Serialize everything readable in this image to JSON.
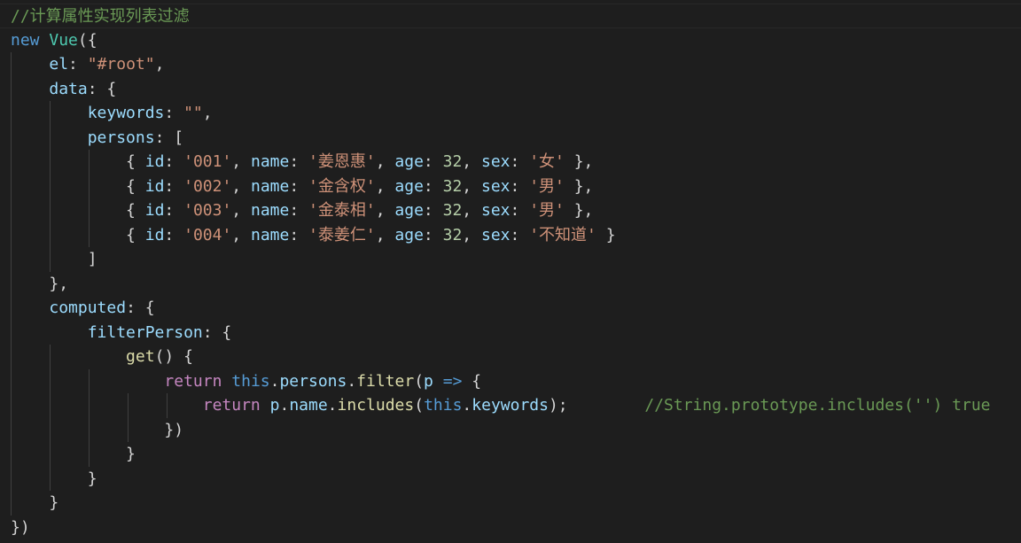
{
  "editor": {
    "colors": {
      "background": "#1e1e1e",
      "comment": "#6a9955",
      "keyword": "#569cd6",
      "control": "#c586c0",
      "class": "#4ec9b0",
      "function": "#dcdcaa",
      "property": "#9cdcfe",
      "string": "#ce9178",
      "number": "#b5cea8",
      "punctuation": "#d4d4d4"
    },
    "lines": [
      {
        "t": [
          {
            "c": "c",
            "v": "//计算属性实现列表过滤"
          }
        ]
      },
      {
        "t": [
          {
            "c": "k",
            "v": "new"
          },
          {
            "c": "sp",
            "v": " "
          },
          {
            "c": "cls",
            "v": "Vue"
          },
          {
            "c": "pu",
            "v": "({"
          }
        ]
      },
      {
        "t": [
          {
            "c": "sp",
            "v": "    "
          },
          {
            "c": "p",
            "v": "el"
          },
          {
            "c": "pu",
            "v": ": "
          },
          {
            "c": "s",
            "v": "\"#root\""
          },
          {
            "c": "pu",
            "v": ","
          }
        ]
      },
      {
        "t": [
          {
            "c": "sp",
            "v": "    "
          },
          {
            "c": "p",
            "v": "data"
          },
          {
            "c": "pu",
            "v": ": {"
          }
        ]
      },
      {
        "t": [
          {
            "c": "sp",
            "v": "        "
          },
          {
            "c": "p",
            "v": "keywords"
          },
          {
            "c": "pu",
            "v": ": "
          },
          {
            "c": "s",
            "v": "\"\""
          },
          {
            "c": "pu",
            "v": ","
          }
        ]
      },
      {
        "t": [
          {
            "c": "sp",
            "v": "        "
          },
          {
            "c": "p",
            "v": "persons"
          },
          {
            "c": "pu",
            "v": ": ["
          }
        ]
      },
      {
        "t": [
          {
            "c": "sp",
            "v": "            "
          },
          {
            "c": "pu",
            "v": "{ "
          },
          {
            "c": "p",
            "v": "id"
          },
          {
            "c": "pu",
            "v": ": "
          },
          {
            "c": "s",
            "v": "'001'"
          },
          {
            "c": "pu",
            "v": ", "
          },
          {
            "c": "p",
            "v": "name"
          },
          {
            "c": "pu",
            "v": ": "
          },
          {
            "c": "s",
            "v": "'姜恩惠'"
          },
          {
            "c": "pu",
            "v": ", "
          },
          {
            "c": "p",
            "v": "age"
          },
          {
            "c": "pu",
            "v": ": "
          },
          {
            "c": "n",
            "v": "32"
          },
          {
            "c": "pu",
            "v": ", "
          },
          {
            "c": "p",
            "v": "sex"
          },
          {
            "c": "pu",
            "v": ": "
          },
          {
            "c": "s",
            "v": "'女'"
          },
          {
            "c": "pu",
            "v": " },"
          }
        ]
      },
      {
        "t": [
          {
            "c": "sp",
            "v": "            "
          },
          {
            "c": "pu",
            "v": "{ "
          },
          {
            "c": "p",
            "v": "id"
          },
          {
            "c": "pu",
            "v": ": "
          },
          {
            "c": "s",
            "v": "'002'"
          },
          {
            "c": "pu",
            "v": ", "
          },
          {
            "c": "p",
            "v": "name"
          },
          {
            "c": "pu",
            "v": ": "
          },
          {
            "c": "s",
            "v": "'金含权'"
          },
          {
            "c": "pu",
            "v": ", "
          },
          {
            "c": "p",
            "v": "age"
          },
          {
            "c": "pu",
            "v": ": "
          },
          {
            "c": "n",
            "v": "32"
          },
          {
            "c": "pu",
            "v": ", "
          },
          {
            "c": "p",
            "v": "sex"
          },
          {
            "c": "pu",
            "v": ": "
          },
          {
            "c": "s",
            "v": "'男'"
          },
          {
            "c": "pu",
            "v": " },"
          }
        ]
      },
      {
        "t": [
          {
            "c": "sp",
            "v": "            "
          },
          {
            "c": "pu",
            "v": "{ "
          },
          {
            "c": "p",
            "v": "id"
          },
          {
            "c": "pu",
            "v": ": "
          },
          {
            "c": "s",
            "v": "'003'"
          },
          {
            "c": "pu",
            "v": ", "
          },
          {
            "c": "p",
            "v": "name"
          },
          {
            "c": "pu",
            "v": ": "
          },
          {
            "c": "s",
            "v": "'金泰相'"
          },
          {
            "c": "pu",
            "v": ", "
          },
          {
            "c": "p",
            "v": "age"
          },
          {
            "c": "pu",
            "v": ": "
          },
          {
            "c": "n",
            "v": "32"
          },
          {
            "c": "pu",
            "v": ", "
          },
          {
            "c": "p",
            "v": "sex"
          },
          {
            "c": "pu",
            "v": ": "
          },
          {
            "c": "s",
            "v": "'男'"
          },
          {
            "c": "pu",
            "v": " },"
          }
        ]
      },
      {
        "t": [
          {
            "c": "sp",
            "v": "            "
          },
          {
            "c": "pu",
            "v": "{ "
          },
          {
            "c": "p",
            "v": "id"
          },
          {
            "c": "pu",
            "v": ": "
          },
          {
            "c": "s",
            "v": "'004'"
          },
          {
            "c": "pu",
            "v": ", "
          },
          {
            "c": "p",
            "v": "name"
          },
          {
            "c": "pu",
            "v": ": "
          },
          {
            "c": "s",
            "v": "'泰姜仁'"
          },
          {
            "c": "pu",
            "v": ", "
          },
          {
            "c": "p",
            "v": "age"
          },
          {
            "c": "pu",
            "v": ": "
          },
          {
            "c": "n",
            "v": "32"
          },
          {
            "c": "pu",
            "v": ", "
          },
          {
            "c": "p",
            "v": "sex"
          },
          {
            "c": "pu",
            "v": ": "
          },
          {
            "c": "s",
            "v": "'不知道'"
          },
          {
            "c": "pu",
            "v": " }"
          }
        ]
      },
      {
        "t": [
          {
            "c": "sp",
            "v": "        "
          },
          {
            "c": "pu",
            "v": "]"
          }
        ]
      },
      {
        "t": [
          {
            "c": "sp",
            "v": "    "
          },
          {
            "c": "pu",
            "v": "},"
          }
        ]
      },
      {
        "t": [
          {
            "c": "sp",
            "v": "    "
          },
          {
            "c": "p",
            "v": "computed"
          },
          {
            "c": "pu",
            "v": ": {"
          }
        ]
      },
      {
        "t": [
          {
            "c": "sp",
            "v": "        "
          },
          {
            "c": "p",
            "v": "filterPerson"
          },
          {
            "c": "pu",
            "v": ": {"
          }
        ]
      },
      {
        "t": [
          {
            "c": "sp",
            "v": "            "
          },
          {
            "c": "fn",
            "v": "get"
          },
          {
            "c": "pu",
            "v": "() {"
          }
        ]
      },
      {
        "t": [
          {
            "c": "sp",
            "v": "                "
          },
          {
            "c": "ctl",
            "v": "return"
          },
          {
            "c": "sp",
            "v": " "
          },
          {
            "c": "k",
            "v": "this"
          },
          {
            "c": "pu",
            "v": "."
          },
          {
            "c": "p",
            "v": "persons"
          },
          {
            "c": "pu",
            "v": "."
          },
          {
            "c": "fn",
            "v": "filter"
          },
          {
            "c": "pu",
            "v": "("
          },
          {
            "c": "v",
            "v": "p"
          },
          {
            "c": "sp",
            "v": " "
          },
          {
            "c": "k",
            "v": "=>"
          },
          {
            "c": "pu",
            "v": " {"
          }
        ]
      },
      {
        "t": [
          {
            "c": "sp",
            "v": "                    "
          },
          {
            "c": "ctl",
            "v": "return"
          },
          {
            "c": "sp",
            "v": " "
          },
          {
            "c": "v",
            "v": "p"
          },
          {
            "c": "pu",
            "v": "."
          },
          {
            "c": "p",
            "v": "name"
          },
          {
            "c": "pu",
            "v": "."
          },
          {
            "c": "fn",
            "v": "includes"
          },
          {
            "c": "pu",
            "v": "("
          },
          {
            "c": "k",
            "v": "this"
          },
          {
            "c": "pu",
            "v": "."
          },
          {
            "c": "p",
            "v": "keywords"
          },
          {
            "c": "pu",
            "v": ");"
          },
          {
            "c": "sp",
            "v": "        "
          },
          {
            "c": "c",
            "v": "//String.prototype.includes('') true"
          }
        ]
      },
      {
        "t": [
          {
            "c": "sp",
            "v": "                "
          },
          {
            "c": "pu",
            "v": "})"
          }
        ]
      },
      {
        "t": [
          {
            "c": "sp",
            "v": "            "
          },
          {
            "c": "pu",
            "v": "}"
          }
        ]
      },
      {
        "t": [
          {
            "c": "sp",
            "v": "        "
          },
          {
            "c": "pu",
            "v": "}"
          }
        ]
      },
      {
        "t": [
          {
            "c": "sp",
            "v": "    "
          },
          {
            "c": "pu",
            "v": "}"
          }
        ]
      },
      {
        "t": [
          {
            "c": "pu",
            "v": "})"
          }
        ]
      }
    ]
  }
}
